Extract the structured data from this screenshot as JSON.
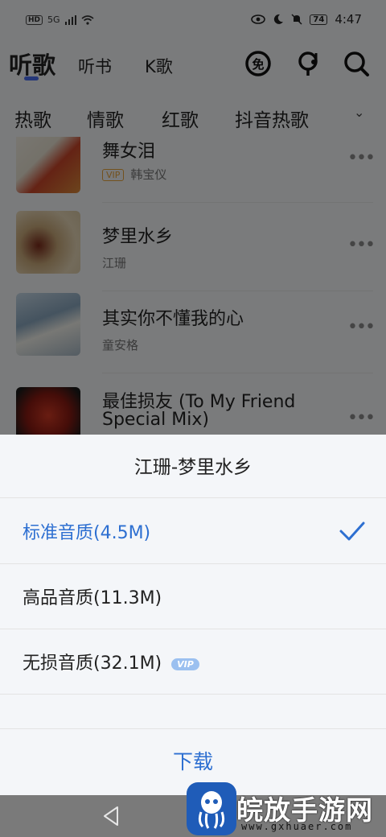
{
  "status_bar": {
    "left_indicators": [
      "HD",
      "5G"
    ],
    "battery": "74",
    "time": "4:47"
  },
  "top_tabs": [
    {
      "label": "听歌",
      "active": true
    },
    {
      "label": "听书",
      "active": false
    },
    {
      "label": "K歌",
      "active": false
    }
  ],
  "top_icons": [
    "free-icon",
    "karaoke-mic-icon",
    "search-icon"
  ],
  "categories": [
    "热歌",
    "情歌",
    "红歌",
    "抖音热歌"
  ],
  "songs": [
    {
      "title": "舞女泪",
      "artist": "韩宝仪",
      "vip": "VIP"
    },
    {
      "title": "梦里水乡",
      "artist": "江珊",
      "vip": ""
    },
    {
      "title": "其实你不懂我的心",
      "artist": "童安格",
      "vip": ""
    },
    {
      "title": "最佳损友 (To My Friend",
      "title2": "Special Mix)",
      "artist": "",
      "vip": ""
    }
  ],
  "more_glyph": "•••",
  "sheet": {
    "title": "江珊-梦里水乡",
    "options": [
      {
        "label": "标准音质(4.5M)",
        "selected": true
      },
      {
        "label": "高品音质(11.3M)",
        "selected": false
      },
      {
        "label": "无损音质(32.1M)",
        "selected": false,
        "badge": "VIP"
      }
    ],
    "download_label": "下载"
  },
  "watermark": {
    "name": "皖放手游网",
    "url": "www.gxhuaer.com"
  },
  "colors": {
    "accent": "#2d6fd1",
    "vip_orange": "#e7a23b",
    "tab_underline": "#4a6ff0"
  }
}
